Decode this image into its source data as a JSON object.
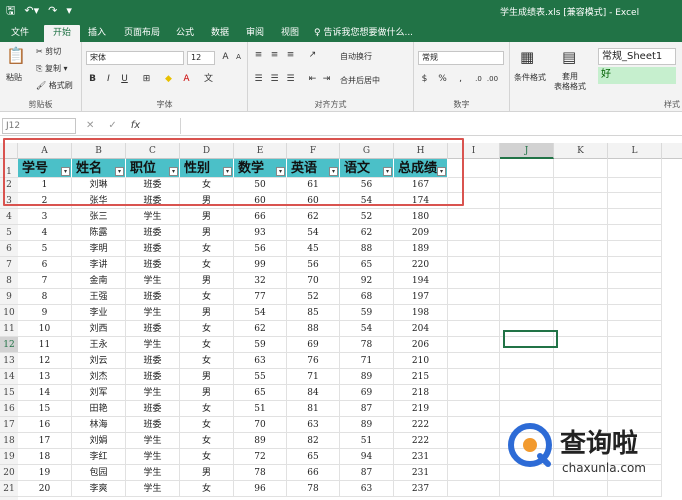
{
  "titlebar": {
    "title": "学生成绩表.xls [兼容模式] - Excel",
    "qat": [
      "save-icon",
      "undo-icon",
      "redo-icon",
      "customize-icon"
    ]
  },
  "tabs": [
    "文件",
    "开始",
    "插入",
    "页面布局",
    "公式",
    "数据",
    "审阅",
    "视图",
    "♀ 告诉我您想要做什么..."
  ],
  "ribbon": {
    "clipboard": {
      "paste": "粘贴",
      "cut": "✂ 剪切",
      "copy": "⎘ 复制 ▾",
      "format_painter": "🖌 格式刷",
      "label": "剪贴板"
    },
    "font": {
      "name": "宋体",
      "size": "12",
      "grow": "A",
      "shrink": "A",
      "bold": "B",
      "italic": "I",
      "underline": "U",
      "label": "字体"
    },
    "alignment": {
      "wrap": "自动换行",
      "merge": "合并后居中",
      "label": "对齐方式"
    },
    "number": {
      "format": "常规",
      "label": "数字"
    },
    "styles": {
      "cond_format": "条件格式",
      "table_format": "套用\n表格格式",
      "normal": "常规_Sheet1",
      "good": "好",
      "label": "样式"
    }
  },
  "formula_bar": {
    "name_box": "J12",
    "cancel": "✕",
    "enter": "✓",
    "fx": "fx",
    "value": ""
  },
  "columns": [
    "A",
    "B",
    "C",
    "D",
    "E",
    "F",
    "G",
    "H",
    "I",
    "J",
    "K",
    "L"
  ],
  "selected_column": "J",
  "selected_row": "12",
  "table": {
    "headers": [
      "学号",
      "姓名",
      "职位",
      "性别",
      "数学",
      "英语",
      "语文",
      "总成绩"
    ],
    "rows": [
      [
        "1",
        "刘琳",
        "班委",
        "女",
        "50",
        "61",
        "56",
        "167"
      ],
      [
        "2",
        "张华",
        "班委",
        "男",
        "60",
        "60",
        "54",
        "174"
      ],
      [
        "3",
        "张三",
        "学生",
        "男",
        "66",
        "62",
        "52",
        "180"
      ],
      [
        "4",
        "陈露",
        "班委",
        "男",
        "93",
        "54",
        "62",
        "209"
      ],
      [
        "5",
        "李明",
        "班委",
        "女",
        "56",
        "45",
        "88",
        "189"
      ],
      [
        "6",
        "李讲",
        "班委",
        "女",
        "99",
        "56",
        "65",
        "220"
      ],
      [
        "7",
        "金南",
        "学生",
        "男",
        "32",
        "70",
        "92",
        "194"
      ],
      [
        "8",
        "王强",
        "班委",
        "女",
        "77",
        "52",
        "68",
        "197"
      ],
      [
        "9",
        "李业",
        "学生",
        "男",
        "54",
        "85",
        "59",
        "198"
      ],
      [
        "10",
        "刘西",
        "班委",
        "女",
        "62",
        "88",
        "54",
        "204"
      ],
      [
        "11",
        "王永",
        "学生",
        "女",
        "59",
        "69",
        "78",
        "206"
      ],
      [
        "12",
        "刘云",
        "班委",
        "女",
        "63",
        "76",
        "71",
        "210"
      ],
      [
        "13",
        "刘杰",
        "班委",
        "男",
        "55",
        "71",
        "89",
        "215"
      ],
      [
        "14",
        "刘军",
        "学生",
        "男",
        "65",
        "84",
        "69",
        "218"
      ],
      [
        "15",
        "田艳",
        "班委",
        "女",
        "51",
        "81",
        "87",
        "219"
      ],
      [
        "16",
        "林海",
        "班委",
        "女",
        "70",
        "63",
        "89",
        "222"
      ],
      [
        "17",
        "刘娟",
        "学生",
        "女",
        "89",
        "82",
        "51",
        "222"
      ],
      [
        "18",
        "李红",
        "学生",
        "女",
        "72",
        "65",
        "94",
        "231"
      ],
      [
        "19",
        "包园",
        "学生",
        "男",
        "78",
        "66",
        "87",
        "231"
      ],
      [
        "20",
        "李爽",
        "学生",
        "女",
        "96",
        "78",
        "63",
        "237"
      ]
    ]
  },
  "watermark": {
    "brand": "查询啦",
    "url": "chaxunla.com"
  }
}
